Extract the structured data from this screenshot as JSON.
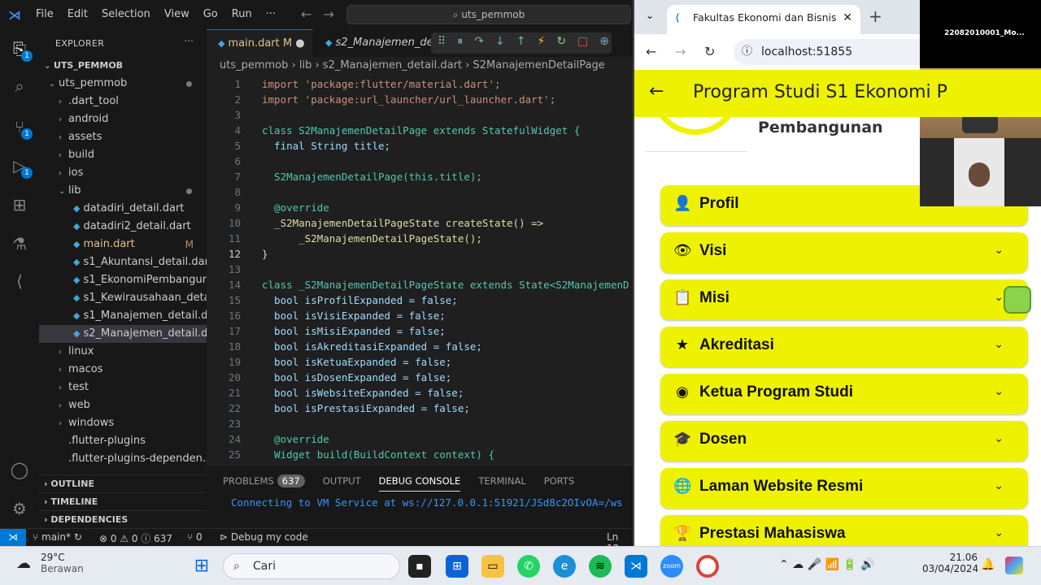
{
  "vscode": {
    "menu": [
      "File",
      "Edit",
      "Selection",
      "View",
      "Go",
      "Run",
      "···"
    ],
    "command_center": "uts_pemmob",
    "explorer_title": "EXPLORER",
    "root": "UTS_PEMMOB",
    "tree": [
      {
        "label": "uts_pemmob",
        "indent": 1,
        "chev": "⌄",
        "dot": true
      },
      {
        "label": ".dart_tool",
        "indent": 2,
        "chev": "›"
      },
      {
        "label": "android",
        "indent": 2,
        "chev": "›"
      },
      {
        "label": "assets",
        "indent": 2,
        "chev": "›"
      },
      {
        "label": "build",
        "indent": 2,
        "chev": "›"
      },
      {
        "label": "ios",
        "indent": 2,
        "chev": "›"
      },
      {
        "label": "lib",
        "indent": 2,
        "chev": "⌄",
        "dot": true
      },
      {
        "label": "datadiri_detail.dart",
        "indent": 3,
        "file": true
      },
      {
        "label": "datadiri2_detail.dart",
        "indent": 3,
        "file": true
      },
      {
        "label": "main.dart",
        "indent": 3,
        "file": true,
        "mod": "M"
      },
      {
        "label": "s1_Akuntansi_detail.dart",
        "indent": 3,
        "file": true
      },
      {
        "label": "s1_EkonomiPembanguna...",
        "indent": 3,
        "file": true
      },
      {
        "label": "s1_Kewirausahaan_detail....",
        "indent": 3,
        "file": true
      },
      {
        "label": "s1_Manajemen_detail.dart",
        "indent": 3,
        "file": true
      },
      {
        "label": "s2_Manajemen_detail.dart",
        "indent": 3,
        "file": true,
        "selected": true
      },
      {
        "label": "linux",
        "indent": 2,
        "chev": "›"
      },
      {
        "label": "macos",
        "indent": 2,
        "chev": "›"
      },
      {
        "label": "test",
        "indent": 2,
        "chev": "›"
      },
      {
        "label": "web",
        "indent": 2,
        "chev": "›"
      },
      {
        "label": "windows",
        "indent": 2,
        "chev": "›"
      },
      {
        "label": ".flutter-plugins",
        "indent": 2,
        "chev": " "
      },
      {
        "label": ".flutter-plugins-dependen...",
        "indent": 2,
        "chev": " "
      }
    ],
    "sections": [
      "OUTLINE",
      "TIMELINE",
      "DEPENDENCIES"
    ],
    "tabs": [
      {
        "label": "main.dart",
        "status": "M"
      },
      {
        "label": "s2_Manajemen_detai"
      }
    ],
    "breadcrumb": "uts_pemmob › lib › s2_Manajemen_detail.dart › S2ManajemenDetailPage",
    "code_lines": [
      {
        "n": "1",
        "t": "import 'package:flutter/material.dart';"
      },
      {
        "n": "2",
        "t": "import 'package:url_launcher/url_launcher.dart';"
      },
      {
        "n": "3",
        "t": ""
      },
      {
        "n": "4",
        "t": "class S2ManajemenDetailPage extends StatefulWidget {"
      },
      {
        "n": "5",
        "t": "  final String title;"
      },
      {
        "n": "6",
        "t": ""
      },
      {
        "n": "7",
        "t": "  S2ManajemenDetailPage(this.title);"
      },
      {
        "n": "8",
        "t": ""
      },
      {
        "n": "9",
        "t": "  @override"
      },
      {
        "n": "10",
        "t": "  _S2ManajemenDetailPageState createState() =>"
      },
      {
        "n": "11",
        "t": "      _S2ManajemenDetailPageState();"
      },
      {
        "n": "12",
        "t": "}"
      },
      {
        "n": "13",
        "t": ""
      },
      {
        "n": "14",
        "t": "class _S2ManajemenDetailPageState extends State<S2ManajemenD"
      },
      {
        "n": "15",
        "t": "  bool isProfilExpanded = false;"
      },
      {
        "n": "16",
        "t": "  bool isVisiExpanded = false;"
      },
      {
        "n": "17",
        "t": "  bool isMisiExpanded = false;"
      },
      {
        "n": "18",
        "t": "  bool isAkreditasiExpanded = false;"
      },
      {
        "n": "19",
        "t": "  bool isKetuaExpanded = false;"
      },
      {
        "n": "20",
        "t": "  bool isDosenExpanded = false;"
      },
      {
        "n": "21",
        "t": "  bool isWebsiteExpanded = false;"
      },
      {
        "n": "22",
        "t": "  bool isPrestasiExpanded = false;"
      },
      {
        "n": "23",
        "t": ""
      },
      {
        "n": "24",
        "t": "  @override"
      },
      {
        "n": "25",
        "t": "  Widget build(BuildContext context) {"
      }
    ],
    "panel_tabs": [
      "PROBLEMS",
      "OUTPUT",
      "DEBUG CONSOLE",
      "TERMINAL",
      "PORTS"
    ],
    "problems_count": "637",
    "console_text": "Connecting to VM Service at ws://127.0.0.1:51921/JSd8c2OIvOA=/ws",
    "status": {
      "branch": "main*",
      "errors": "⊗ 0 ⚠ 0 ⓘ 637",
      "ports": "⑂ 0",
      "debug": "Debug my code",
      "pos": "Ln 12,"
    }
  },
  "browser": {
    "tab_title": "Fakultas Ekonomi dan Bisnis",
    "url": "localhost:51855",
    "appbar_title": "Program Studi S1 Ekonomi P",
    "subtitle": "Pembangunan",
    "accordion": [
      {
        "icon": "person-icon",
        "glyph": "👤",
        "label": "Profil"
      },
      {
        "icon": "eye-icon",
        "glyph": "👁",
        "label": "Visi"
      },
      {
        "icon": "clipboard-icon",
        "glyph": "📋",
        "label": "Misi"
      },
      {
        "icon": "star-icon",
        "glyph": "★",
        "label": "Akreditasi"
      },
      {
        "icon": "account-circle-icon",
        "glyph": "◉",
        "label": "Ketua Program Studi"
      },
      {
        "icon": "school-icon",
        "glyph": "🎓",
        "label": "Dosen"
      },
      {
        "icon": "globe-icon",
        "glyph": "🌐",
        "label": "Laman Website Resmi"
      },
      {
        "icon": "trophy-icon",
        "glyph": "🏆",
        "label": "Prestasi Mahasiswa"
      }
    ]
  },
  "video": {
    "participant": "22082010001_Mo..."
  },
  "taskbar": {
    "temp": "29°C",
    "weather": "Berawan",
    "search": "Cari",
    "time": "21.06",
    "date": "03/04/2024"
  }
}
